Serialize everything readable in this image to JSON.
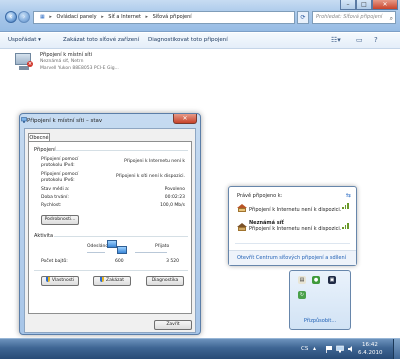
{
  "explorer": {
    "breadcrumbs": [
      "Ovládací panely",
      "Síť a Internet",
      "Síťová připojení"
    ],
    "search_placeholder": "Prohledat: Síťová připojení",
    "toolbar": {
      "organize": "Uspořádat ▾",
      "disable": "Zakázat toto síťové zařízení",
      "diagnose": "Diagnostikovat toto připojení"
    },
    "adapter": {
      "name": "Připojení k místní síti",
      "status": "Neznámá síť, Netrn",
      "device": "Marvell Yukon 88E8053 PCI-E Gig..."
    }
  },
  "dialog": {
    "title": "Připojení k místní síti – stav",
    "tab": "Obecné",
    "connection_group": "Připojení",
    "rows": [
      {
        "label": "Připojení pomocí protokolu IPv4:",
        "value": "Připojeni k Internetu není k"
      },
      {
        "label": "Připojení pomocí protokolu IPv6:",
        "value": "Připojeni k síti není k dispozici."
      },
      {
        "label": "Stav médi a:",
        "value": "Povoleno"
      },
      {
        "label": "Doba trvání:",
        "value": "00:02:23"
      },
      {
        "label": "Rychlost:",
        "value": "100,0 Mb/s"
      }
    ],
    "details_button": "Podrobnosti...",
    "activity_group": "Aktivita",
    "sent_label": "Odesláno",
    "received_label": "Přijato",
    "bytes_label": "Počet bajtů:",
    "sent_value": "600",
    "received_value": "3 520",
    "properties_button": "Vlastnosti",
    "disable_button": "Zakázat",
    "diagnose_button": "Diagnostika",
    "close_button": "Zavřít"
  },
  "flyout": {
    "header": "Právě připojeno k:",
    "networks": [
      {
        "name": "",
        "status": "Připojení k Internetu není k dispozici."
      },
      {
        "name": "Neznámá síť",
        "status": "Připojení k Internetu není k dispozici."
      }
    ],
    "footer_link": "Otevřít Centrum síťových připojení a sdílení"
  },
  "overflow": {
    "customize_link": "Přizpůsobit..."
  },
  "taskbar": {
    "language": "CS",
    "time": "16:42",
    "date": "6.4.2010"
  },
  "colors": {
    "link": "#1e5fb5",
    "close_red": "#c7432b"
  }
}
